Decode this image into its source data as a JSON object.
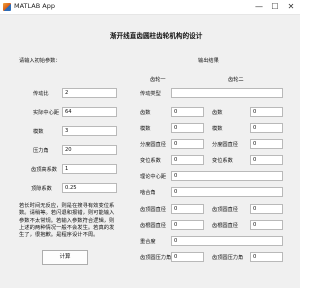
{
  "window": {
    "title": "MATLAB App",
    "minimize": "—",
    "maximize": "☐",
    "close": "✕"
  },
  "main": {
    "title": "渐开线直齿圆柱齿轮机构的设计"
  },
  "left": {
    "heading": "请输入初始参数：",
    "params": [
      {
        "label": "传动比",
        "value": "2"
      },
      {
        "label": "实际中心距",
        "value": "64"
      },
      {
        "label": "模数",
        "value": "3"
      },
      {
        "label": "压力角",
        "value": "20"
      },
      {
        "label": "齿顶高系数",
        "value": "1"
      },
      {
        "label": "顶隙系数",
        "value": "0.25"
      }
    ],
    "note": "若长时间无反应，则是在搜寻有效变位系数。请稍等。若闪退和报错，则可能输入参数不太常规。若输入参数符合逻辑，则上述的两种情况一般不会发生。若真的发生了，很抱歉。是程序设计不周。",
    "calc_label": "计算"
  },
  "right": {
    "heading": "输出结果",
    "col1": "齿轮一",
    "col2": "齿轮二",
    "drive_type_label": "传动类型",
    "drive_type_value": "",
    "rows": [
      {
        "l1": "齿数",
        "v1": "0",
        "l2": "齿数",
        "v2": "0"
      },
      {
        "l1": "模数",
        "v1": "0",
        "l2": "模数",
        "v2": "0"
      },
      {
        "l1": "分度圆直径",
        "v1": "0",
        "l2": "分度圆直径",
        "v2": "0"
      },
      {
        "l1": "变位系数",
        "v1": "0",
        "l2": "变位系数",
        "v2": "0"
      }
    ],
    "center_label": "理论中心距",
    "center_value": "0",
    "mesh_label": "啮合角",
    "mesh_value": "0",
    "rows2": [
      {
        "l1": "齿顶圆直径",
        "v1": "0",
        "l2": "齿顶圆直径",
        "v2": "0"
      },
      {
        "l1": "齿根圆直径",
        "v1": "0",
        "l2": "齿根圆直径",
        "v2": "0"
      }
    ],
    "overlap_label": "重合度",
    "overlap_value": "0",
    "rows3": [
      {
        "l1": "齿顶圆压力角",
        "v1": "0",
        "l2": "齿顶圆压力角",
        "v2": "0"
      }
    ]
  }
}
